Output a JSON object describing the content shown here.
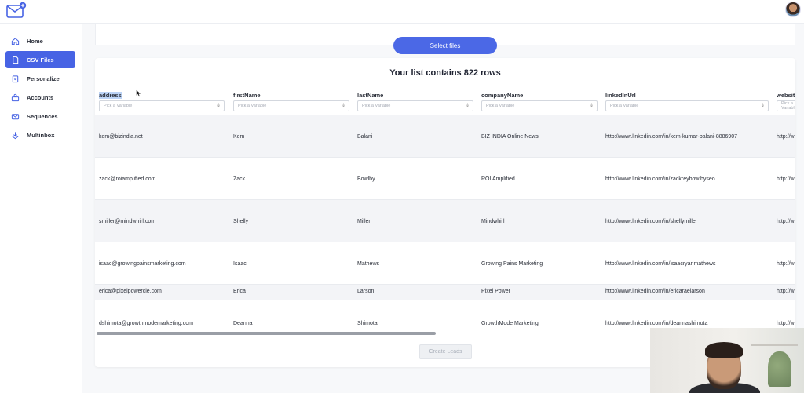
{
  "sidebar": {
    "items": [
      {
        "label": "Home",
        "icon": "home-icon",
        "active": false
      },
      {
        "label": "CSV Files",
        "icon": "file-icon",
        "active": true
      },
      {
        "label": "Personalize",
        "icon": "clipboard-icon",
        "active": false
      },
      {
        "label": "Accounts",
        "icon": "accounts-icon",
        "active": false
      },
      {
        "label": "Sequences",
        "icon": "mail-icon",
        "active": false
      },
      {
        "label": "Multinbox",
        "icon": "inbox-icon",
        "active": false
      }
    ]
  },
  "upload": {
    "select_label": "Select files"
  },
  "list": {
    "title": "Your list contains 822 rows"
  },
  "table": {
    "placeholder": "Pick a Variable",
    "columns": [
      "address",
      "firstName",
      "lastName",
      "companyName",
      "linkedInUrl",
      "websit"
    ],
    "rows": [
      [
        "kem@bizindia.net",
        "Kem",
        "Balani",
        "BIZ INDIA Online News",
        "http://www.linkedin.com/in/kem-kumar-balani-8886907",
        "http://w"
      ],
      [
        "zack@roiamplified.com",
        "Zack",
        "Bowlby",
        "ROI Amplified",
        "http://www.linkedin.com/in/zackreybowlbyseo",
        "http://w"
      ],
      [
        "smiller@mindwhirl.com",
        "Shelly",
        "Miller",
        "Mindwhirl",
        "http://www.linkedin.com/in/shellymiller",
        "http://w"
      ],
      [
        "isaac@growingpainsmarketing.com",
        "Isaac",
        "Mathews",
        "Growing Pains Marketing",
        "http://www.linkedin.com/in/isaacryanmathews",
        "http://w"
      ],
      [
        "erica@pixelpowercle.com",
        "Erica",
        "Larson",
        "Pixel Power",
        "http://www.linkedin.com/in/ericaraelarson",
        "http://w"
      ],
      [
        "dshimota@growthmodemarketing.com",
        "Deanna",
        "Shimota",
        "GrowthMode Marketing",
        "http://www.linkedin.com/in/deannashimota",
        "http://w"
      ]
    ]
  },
  "actions": {
    "create_label": "Create Leads"
  },
  "colors": {
    "accent": "#4763e4",
    "button": "#4b68e6",
    "selection": "#bcd3f5"
  }
}
